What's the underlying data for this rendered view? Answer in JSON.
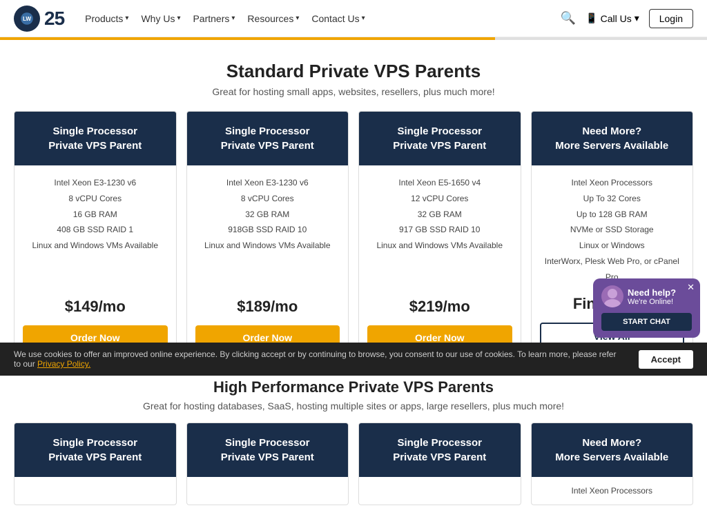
{
  "navbar": {
    "logo_text": "Liquid Web",
    "logo_25": "25",
    "nav_items": [
      {
        "label": "Products",
        "has_dropdown": true
      },
      {
        "label": "Why Us",
        "has_dropdown": true
      },
      {
        "label": "Partners",
        "has_dropdown": true
      },
      {
        "label": "Resources",
        "has_dropdown": true
      },
      {
        "label": "Contact Us",
        "has_dropdown": true
      }
    ],
    "call_label": "Call Us",
    "login_label": "Login"
  },
  "section1": {
    "title": "Standard Private VPS Parents",
    "subtitle": "Great for hosting small apps, websites, resellers, plus much more!"
  },
  "cards": [
    {
      "header": "Single Processor\nPrivate VPS Parent",
      "specs": [
        "Intel Xeon E3-1230 v6",
        "8 vCPU Cores",
        "16 GB RAM",
        "408 GB SSD RAID 1",
        "Linux and Windows VMs Available"
      ],
      "price": "$149/mo",
      "btn_label": "Order Now",
      "btn_type": "order"
    },
    {
      "header": "Single Processor\nPrivate VPS Parent",
      "specs": [
        "Intel Xeon E3-1230 v6",
        "8 vCPU Cores",
        "32 GB RAM",
        "918GB SSD RAID 10",
        "Linux and Windows VMs Available"
      ],
      "price": "$189/mo",
      "btn_label": "Order Now",
      "btn_type": "order"
    },
    {
      "header": "Single Processor\nPrivate VPS Parent",
      "specs": [
        "Intel Xeon E5-1650 v4",
        "12 vCPU Cores",
        "32 GB RAM",
        "917 GB SSD RAID 10",
        "Linux and Windows VMs Available"
      ],
      "price": "$219/mo",
      "btn_label": "Order Now",
      "btn_type": "order"
    },
    {
      "header": "Need More?\nMore Servers Available",
      "specs": [
        "Intel Xeon Processors",
        "Up To 32 Cores",
        "Up to 128 GB RAM",
        "NVMe or SSD Storage",
        "Linux or Windows",
        "InterWorx, Plesk Web Pro, or cPanel Pro"
      ],
      "price": "Find Yours",
      "btn_label": "View All",
      "btn_type": "view"
    }
  ],
  "section2": {
    "title": "High Performance Private VPS Parents",
    "subtitle": "Great for hosting databases, SaaS, hosting multiple sites or apps, large resellers, plus much more!"
  },
  "cards2": [
    {
      "header": "Single Processor\nPrivate VPS Parent",
      "specs": []
    },
    {
      "header": "Single Processor\nPrivate VPS Parent",
      "specs": []
    },
    {
      "header": "Single Processor\nPrivate VPS Parent",
      "specs": []
    },
    {
      "header": "Need More?\nMore Servers Available",
      "specs": [
        "Intel Xeon Processors"
      ]
    }
  ],
  "cookie": {
    "text": "We use cookies to offer an improved online experience. By clicking accept or by continuing to browse, you consent to our use of cookies. To learn more, please refer to our ",
    "link_text": "Privacy Policy.",
    "accept_label": "Accept"
  },
  "chat": {
    "title": "Need help?",
    "subtitle": "We're Online!",
    "btn_label": "START CHAT"
  }
}
